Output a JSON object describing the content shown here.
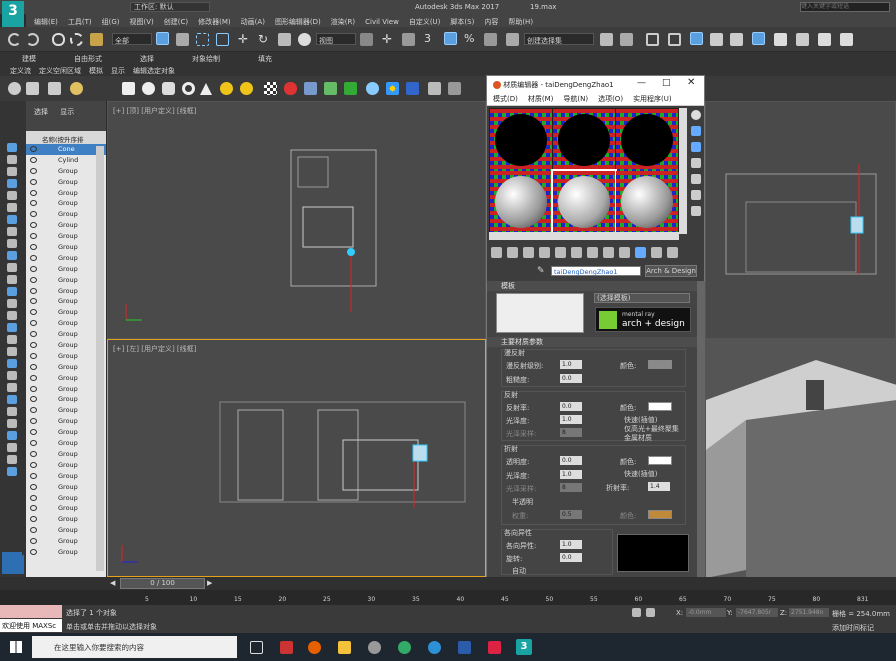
{
  "window": {
    "app_title": "Autodesk 3ds Max 2017",
    "file": "19.max",
    "workspace": "工作区: 默认",
    "search_placeholder": "键入关键字或短语"
  },
  "menus": [
    "编辑(E)",
    "工具(T)",
    "组(G)",
    "视图(V)",
    "创建(C)",
    "修改器(M)",
    "动画(A)",
    "图形编辑器(D)",
    "渲染(R)",
    "Civil View",
    "自定义(U)",
    "脚本(S)",
    "内容",
    "帮助(H)"
  ],
  "toolbar": {
    "filter": "全部",
    "view": "视图",
    "selection_set": "创建选择集"
  },
  "ribbon": {
    "tabs": [
      "建模",
      "自由形式",
      "选择",
      "对象绘制",
      "填充"
    ],
    "sub": [
      "定义流",
      "定义空闲区域",
      "模拟",
      "显示",
      "编辑选定对象"
    ]
  },
  "scene_explorer": {
    "tabs": [
      "选择",
      "显示"
    ],
    "column": "名称(按升序排序)",
    "items": [
      "Cone",
      "Cylind",
      "Group",
      "Group",
      "Group",
      "Group",
      "Group",
      "Group",
      "Group",
      "Group",
      "Group",
      "Group",
      "Group",
      "Group",
      "Group",
      "Group",
      "Group",
      "Group",
      "Group",
      "Group",
      "Group",
      "Group",
      "Group",
      "Group",
      "Group",
      "Group",
      "Group",
      "Group",
      "Group",
      "Group",
      "Group",
      "Group",
      "Group",
      "Group",
      "Group",
      "Group",
      "Group",
      "Group"
    ]
  },
  "viewports": {
    "top": "[+] [顶] [用户定义] [线框]",
    "left": "[+] [左] [用户定义] [线框]"
  },
  "material_editor": {
    "title": "材质编辑器 - taiDengDengZhao1",
    "menus": [
      "模式(D)",
      "材质(M)",
      "导航(N)",
      "选项(O)",
      "实用程序(U)"
    ],
    "name": "taiDengDengZhao1",
    "type": "Arch & Design",
    "templates_label": "模板",
    "template_select": "(选择模板)",
    "mr_logo_top": "mental ray",
    "mr_logo_bottom": "arch + design",
    "main_label": "主要材质参数",
    "diffuse": {
      "group": "漫反射",
      "level_label": "漫反射级别:",
      "level": "1.0",
      "rough_label": "粗糙度:",
      "rough": "0.0",
      "color_label": "颜色:"
    },
    "reflection": {
      "group": "反射",
      "refl_label": "反射率:",
      "refl": "0.0",
      "gloss_label": "光泽度:",
      "gloss": "1.0",
      "samples_label": "光泽采样:",
      "samples": "8",
      "color_label": "颜色:",
      "cb1": "快速(插值)",
      "cb2": "仅高光+最终聚集",
      "cb3": "金属材质"
    },
    "refraction": {
      "group": "折射",
      "trans_label": "透明度:",
      "trans": "0.0",
      "gloss_label": "光泽度:",
      "gloss": "1.0",
      "samples_label": "光泽采样:",
      "samples": "8",
      "color_label": "颜色:",
      "cb1": "快速(插值)",
      "ior_label": "折射率:",
      "ior": "1.4",
      "translucency": "半透明",
      "weight_label": "权重:",
      "weight": "0.5",
      "color2_label": "颜色:"
    },
    "aniso": {
      "group": "各向异性",
      "aniso_label": "各向异性:",
      "aniso": "1.0",
      "rot_label": "旋转:",
      "rot": "0.0",
      "more": "自动"
    },
    "colors": {
      "diffuse": "#8a8a8a",
      "reflect": "#ffffff",
      "refract": "#ffffff",
      "transluc": "#c08a3a"
    }
  },
  "timeline": {
    "frame": "0 / 100"
  },
  "ruler": [
    "5",
    "10",
    "15",
    "20",
    "25",
    "30",
    "35",
    "40",
    "45",
    "50",
    "55",
    "60",
    "65",
    "70",
    "75",
    "80",
    "831"
  ],
  "status": {
    "welcome": "欢迎使用 MAXSc",
    "selected": "选择了 1 个对象",
    "hint": "单击或单击并拖动以选择对象",
    "x_label": "X:",
    "x": "-0.0mm",
    "y_label": "Y:",
    "y": "-7647.805r",
    "z_label": "Z:",
    "z": "2751.948n",
    "grid": "栅格 = 254.0mm",
    "add_time": "添加时间标记"
  },
  "taskbar": {
    "search": "在这里输入你要搜索的内容"
  }
}
